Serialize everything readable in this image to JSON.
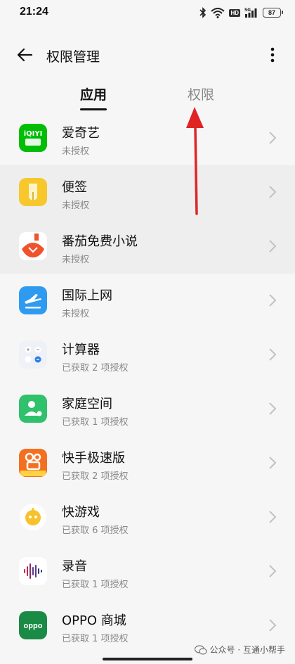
{
  "status_bar": {
    "time": "21:24",
    "hd": "HD",
    "network": "5G",
    "battery": "87"
  },
  "app_bar": {
    "title": "权限管理",
    "back_icon": "back-arrow-icon",
    "more_icon": "more-vertical-icon"
  },
  "tabs": [
    {
      "label": "应用",
      "active": true
    },
    {
      "label": "权限",
      "active": false
    }
  ],
  "apps": [
    {
      "name": "爱奇艺",
      "status": "未授权",
      "icon": "iqiyi-icon",
      "color": "#00be06"
    },
    {
      "name": "便签",
      "status": "未授权",
      "icon": "notes-icon",
      "color": "#f7c72c"
    },
    {
      "name": "番茄免费小说",
      "status": "未授权",
      "icon": "tomato-novel-icon",
      "color": "#f0522c"
    },
    {
      "name": "国际上网",
      "status": "未授权",
      "icon": "airplane-icon",
      "color": "#2e9bf0"
    },
    {
      "name": "计算器",
      "status": "已获取 2 项授权",
      "icon": "calculator-icon",
      "color": "#eef1f6"
    },
    {
      "name": "家庭空间",
      "status": "已获取 1 项授权",
      "icon": "family-space-icon",
      "color": "#2fc16b"
    },
    {
      "name": "快手极速版",
      "status": "已获取 2 项授权",
      "icon": "kuaishou-lite-icon",
      "color": "#f47021"
    },
    {
      "name": "快游戏",
      "status": "已获取 6 项授权",
      "icon": "quick-game-icon",
      "color": "#f7c22d"
    },
    {
      "name": "录音",
      "status": "已获取 1 项授权",
      "icon": "recorder-icon",
      "color": "#ffffff"
    },
    {
      "name": "OPPO 商城",
      "status": "已获取 1 项授权",
      "icon": "oppo-store-icon",
      "color": "#1a8a44"
    }
  ],
  "watermark": "公众号 · 互通小帮手",
  "annotation": {
    "type": "arrow",
    "color": "#e02424",
    "points_to": "权限"
  }
}
